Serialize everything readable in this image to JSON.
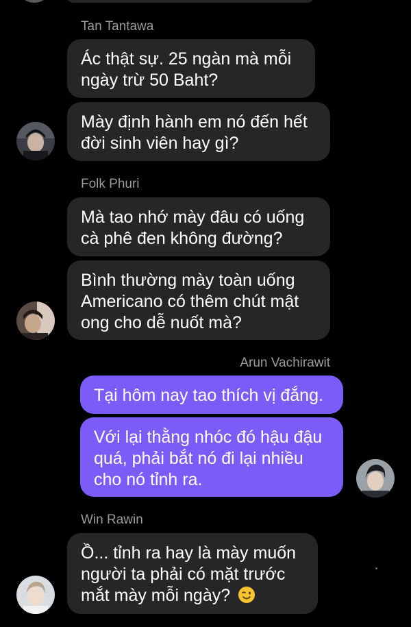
{
  "messages": [
    {
      "sender": "Tan Tantawa",
      "direction": "incoming",
      "bubbles": [
        "Ác thật sự. 25 ngàn mà mỗi ngày trừ 50 Baht?",
        "Mày định hành em nó đến hết đời sinh viên hay gì?"
      ]
    },
    {
      "sender": "Folk Phuri",
      "direction": "incoming",
      "bubbles": [
        "Mà tao nhớ mày đâu có uống cà phê đen không đường?",
        "Bình thường mày toàn uống Americano có thêm chút mật ong cho dễ nuốt mà?"
      ]
    },
    {
      "sender": "Arun Vachirawit",
      "direction": "outgoing",
      "bubbles": [
        "Tại hôm nay tao thích vị đắng.",
        "Với lại thằng nhóc đó hậu đậu quá, phải bắt nó đi lại nhiều cho nó tỉnh ra."
      ]
    },
    {
      "sender": "Win Rawin",
      "direction": "incoming",
      "bubbles": [
        "Ồ... tỉnh ra hay là mày muốn người ta phải có mặt trước mắt mày mỗi ngày?"
      ],
      "trailing_emoji": "winking-face-emoji"
    }
  ],
  "colors": {
    "background": "#000000",
    "incoming_bubble": "#262628",
    "outgoing_bubble": "#7c5cf8",
    "sender_name": "#9a9a9e",
    "message_text": "#ffffff"
  }
}
